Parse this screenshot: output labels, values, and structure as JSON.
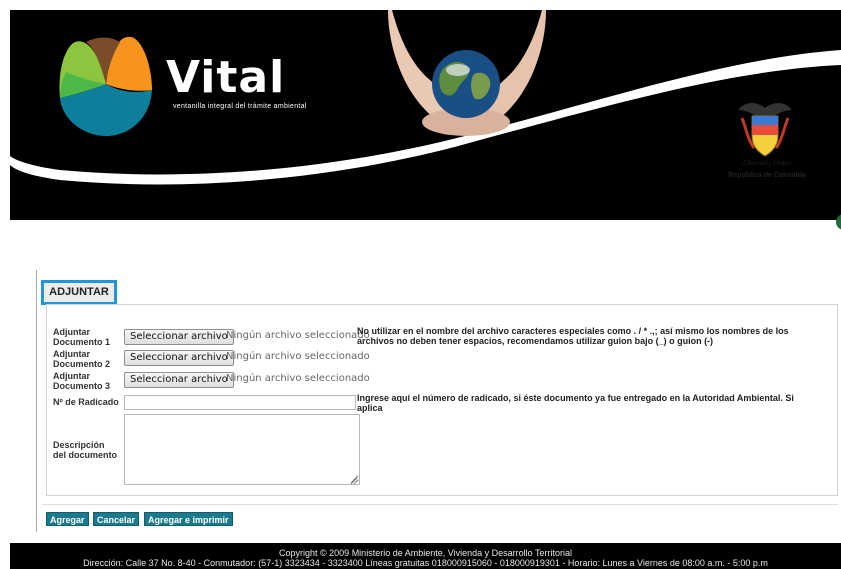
{
  "header": {
    "brand_name": "Vital",
    "tagline": "ventanilla integral del trámite ambiental",
    "motto": "Libertad y Orden",
    "country": "República de Colombia"
  },
  "form": {
    "tab_label": "ADJUNTAR",
    "rows": [
      {
        "label_line1": "Adjuntar",
        "label_line2": "Documento 1",
        "button": "Seleccionar archivo",
        "status": "Ningún archivo seleccionado"
      },
      {
        "label_line1": "Adjuntar",
        "label_line2": "Documento 2",
        "button": "Seleccionar archivo",
        "status": "Ningún archivo seleccionado"
      },
      {
        "label_line1": "Adjuntar",
        "label_line2": "Documento 3",
        "button": "Seleccionar archivo",
        "status": "Ningún archivo seleccionado"
      }
    ],
    "file_help_line1": "No utilizar en el nombre del archivo caracteres especiales como . / * .,; así mismo los nombres de los",
    "file_help_line2": "archivos no deben tener espacios, recomendamos utilizar guion bajo (_) o guion (-)",
    "radicado_label": "Nº de Radicado",
    "radicado_value": "",
    "radicado_help_line1": "Ingrese aquí el número de radicado, si éste documento ya fue entregado en la Autoridad Ambiental. Si",
    "radicado_help_line2": "aplica",
    "descripcion_label_line1": "Descripción",
    "descripcion_label_line2": "del documento",
    "descripcion_value": ""
  },
  "actions": {
    "add": "Agregar",
    "cancel": "Cancelar",
    "add_print": "Agregar e imprimir"
  },
  "footer": {
    "line1": "Copyright © 2009 Ministerio de Ambiente, Vivienda y Desarrollo Territorial",
    "line2": "Dirección: Calle 37 No. 8-40 - Conmutador: (57-1) 3323434 - 3323400 Líneas gratuitas 018000915060 - 018000919301 - Horario: Lunes a Viernes de 08:00 a.m. - 5:00 p.m"
  },
  "colors": {
    "accent_blue": "#1e96d8",
    "button_teal": "#1b7a8c",
    "header_black": "#000000"
  }
}
